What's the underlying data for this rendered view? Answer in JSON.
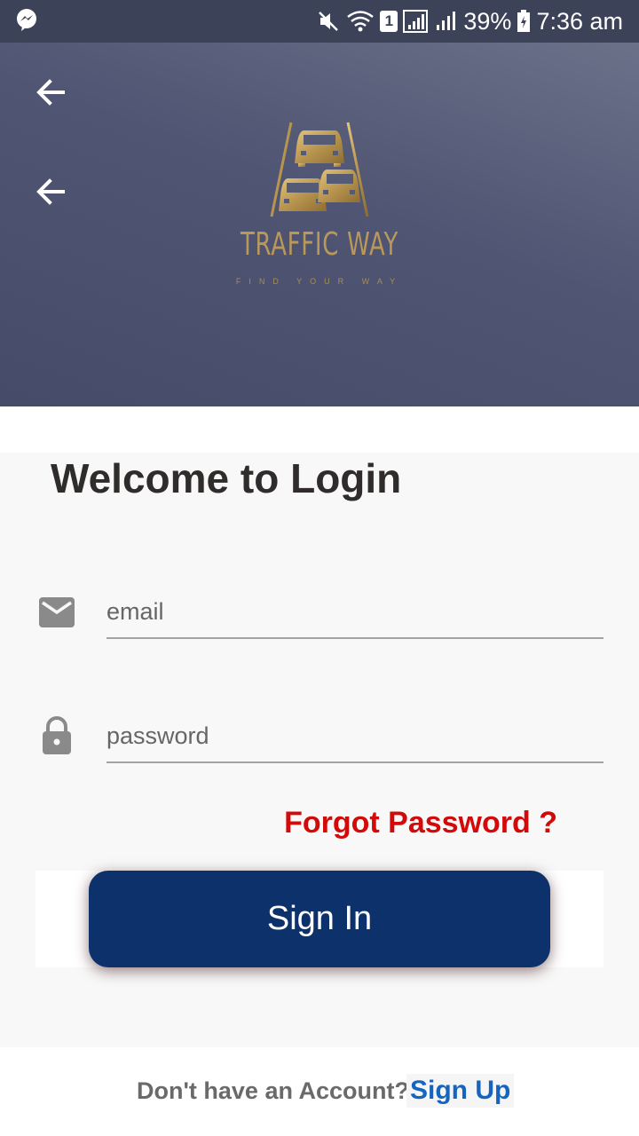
{
  "status_bar": {
    "battery": "39%",
    "time": "7:36 am",
    "sim": "1",
    "icons": [
      "messenger-icon",
      "mute-icon",
      "wifi-icon",
      "signal-icon",
      "signal-icon",
      "battery-icon"
    ]
  },
  "header": {
    "back_icons": [
      "back-arrow-icon",
      "back-arrow-icon"
    ],
    "brand_name": "TRAFFIC WAY",
    "brand_tagline": "FIND YOUR WAY",
    "logo_icon": "traffic-cars-logo"
  },
  "login": {
    "title": "Welcome to Login",
    "email_placeholder": "email",
    "email_icon": "mail-icon",
    "password_placeholder": "password",
    "password_icon": "lock-icon",
    "forgot_label": "Forgot Password ?",
    "signin_label": "Sign In"
  },
  "footer": {
    "prompt": "Don't have an Account?",
    "signup_label": "Sign Up"
  },
  "colors": {
    "header_bg": "#4f5572",
    "brand_gold": "#b9985a",
    "primary_button": "#0c316b",
    "forgot_red": "#d30a0a",
    "link_blue": "#1565c0"
  }
}
